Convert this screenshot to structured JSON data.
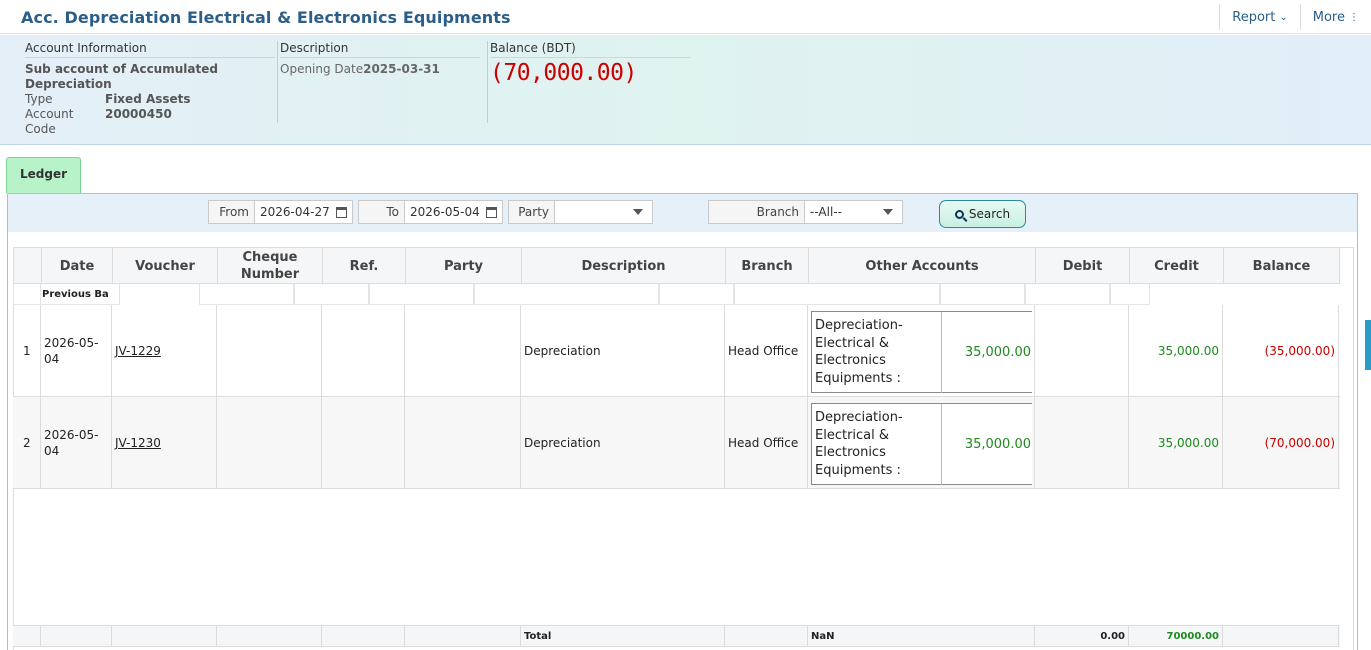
{
  "header": {
    "title": "Acc. Depreciation Electrical & Electronics Equipments",
    "report_label": "Report",
    "more_label": "More"
  },
  "info": {
    "account_info_label": "Account Information",
    "sub_account": "Sub account of Accumulated Depreciation",
    "type_label": "Type",
    "type_value": "Fixed Assets",
    "account_code_label": "Account Code",
    "account_code_value": "20000450",
    "description_label": "Description",
    "opening_date_label": "Opening Date",
    "opening_date_value": "2025-03-31",
    "balance_label": "Balance (BDT)",
    "balance_value": "(70,000.00)"
  },
  "tabs": {
    "ledger": "Ledger"
  },
  "filters": {
    "from_label": "From",
    "from_value": "2026-04-27",
    "to_label": "To",
    "to_value": "2026-05-04",
    "party_label": "Party",
    "party_value": "",
    "branch_label": "Branch",
    "branch_value": "--All--",
    "search_label": "Search"
  },
  "table": {
    "columns": [
      "Date",
      "Voucher",
      "Cheque Number",
      "Ref.",
      "Party",
      "Description",
      "Branch",
      "Other Accounts",
      "Debit",
      "Credit",
      "Balance"
    ],
    "previous_balance_label": "Previous Ba",
    "rows": [
      {
        "index": "1",
        "date": "2026-05-04",
        "voucher": "JV-1229",
        "cheque": "",
        "ref": "",
        "party": "",
        "description": "Depreciation",
        "branch": "Head Office",
        "other_account": "Depreciation-Electrical & Electronics Equipments :",
        "other_amount": "35,000.00",
        "debit": "",
        "credit": "35,000.00",
        "balance": "(35,000.00)"
      },
      {
        "index": "2",
        "date": "2026-05-04",
        "voucher": "JV-1230",
        "cheque": "",
        "ref": "",
        "party": "",
        "description": "Depreciation",
        "branch": "Head Office",
        "other_account": "Depreciation-Electrical & Electronics Equipments :",
        "other_amount": "35,000.00",
        "debit": "",
        "credit": "35,000.00",
        "balance": "(70,000.00)"
      }
    ],
    "totals": {
      "label": "Total",
      "other_accounts": "NaN",
      "debit": "0.00",
      "credit": "70000.00"
    }
  }
}
